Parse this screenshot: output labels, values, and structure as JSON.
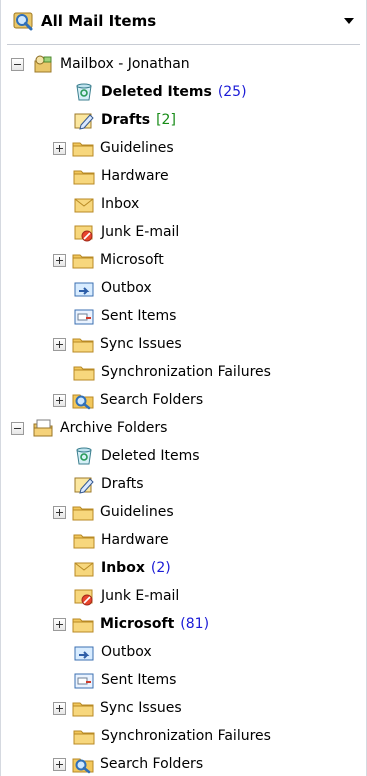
{
  "header": {
    "title": "All Mail Items",
    "icon": "search-folder-icon"
  },
  "tree": [
    {
      "id": "mailbox",
      "label": "Mailbox - Jonathan",
      "icon": "mailbox-icon",
      "expander": "minus",
      "level": 0,
      "bold": false
    },
    {
      "id": "mb-deleted",
      "label": "Deleted Items",
      "icon": "deleted-items-icon",
      "expander": "",
      "level": 1,
      "bold": true,
      "count": "(25)",
      "count_color": "blue"
    },
    {
      "id": "mb-drafts",
      "label": "Drafts",
      "icon": "drafts-icon",
      "expander": "",
      "level": 1,
      "bold": true,
      "count": "[2]",
      "count_color": "green"
    },
    {
      "id": "mb-guidelines",
      "label": "Guidelines",
      "icon": "folder-icon",
      "expander": "plus",
      "level": 1,
      "bold": false
    },
    {
      "id": "mb-hardware",
      "label": "Hardware",
      "icon": "folder-icon",
      "expander": "",
      "level": 1,
      "bold": false
    },
    {
      "id": "mb-inbox",
      "label": "Inbox",
      "icon": "inbox-icon",
      "expander": "",
      "level": 1,
      "bold": false
    },
    {
      "id": "mb-junk",
      "label": "Junk E-mail",
      "icon": "junk-email-icon",
      "expander": "",
      "level": 1,
      "bold": false
    },
    {
      "id": "mb-microsoft",
      "label": "Microsoft",
      "icon": "folder-icon",
      "expander": "plus",
      "level": 1,
      "bold": false
    },
    {
      "id": "mb-outbox",
      "label": "Outbox",
      "icon": "outbox-icon",
      "expander": "",
      "level": 1,
      "bold": false
    },
    {
      "id": "mb-sent",
      "label": "Sent Items",
      "icon": "sent-items-icon",
      "expander": "",
      "level": 1,
      "bold": false
    },
    {
      "id": "mb-sync",
      "label": "Sync Issues",
      "icon": "folder-icon",
      "expander": "plus",
      "level": 1,
      "bold": false
    },
    {
      "id": "mb-syncfail",
      "label": "Synchronization  Failures",
      "icon": "folder-icon",
      "expander": "",
      "level": 2,
      "bold": false
    },
    {
      "id": "mb-search",
      "label": "Search Folders",
      "icon": "search-folders-icon",
      "expander": "plus",
      "level": 1,
      "bold": false
    },
    {
      "id": "archive",
      "label": "Archive Folders",
      "icon": "archive-icon",
      "expander": "minus",
      "level": 0,
      "bold": false
    },
    {
      "id": "ar-deleted",
      "label": "Deleted Items",
      "icon": "deleted-items-icon",
      "expander": "",
      "level": 1,
      "bold": false
    },
    {
      "id": "ar-drafts",
      "label": "Drafts",
      "icon": "drafts-icon",
      "expander": "",
      "level": 1,
      "bold": false
    },
    {
      "id": "ar-guidelines",
      "label": "Guidelines",
      "icon": "folder-icon",
      "expander": "plus",
      "level": 1,
      "bold": false
    },
    {
      "id": "ar-hardware",
      "label": "Hardware",
      "icon": "folder-icon",
      "expander": "",
      "level": 1,
      "bold": false
    },
    {
      "id": "ar-inbox",
      "label": "Inbox",
      "icon": "inbox-icon",
      "expander": "",
      "level": 1,
      "bold": true,
      "count": "(2)",
      "count_color": "blue"
    },
    {
      "id": "ar-junk",
      "label": "Junk E-mail",
      "icon": "junk-email-icon",
      "expander": "",
      "level": 1,
      "bold": false
    },
    {
      "id": "ar-microsoft",
      "label": "Microsoft",
      "icon": "folder-icon",
      "expander": "plus",
      "level": 1,
      "bold": true,
      "count": "(81)",
      "count_color": "blue"
    },
    {
      "id": "ar-outbox",
      "label": "Outbox",
      "icon": "outbox-icon",
      "expander": "",
      "level": 1,
      "bold": false
    },
    {
      "id": "ar-sent",
      "label": "Sent Items",
      "icon": "sent-items-icon",
      "expander": "",
      "level": 1,
      "bold": false
    },
    {
      "id": "ar-sync",
      "label": "Sync Issues",
      "icon": "folder-icon",
      "expander": "plus",
      "level": 1,
      "bold": false
    },
    {
      "id": "ar-syncfail",
      "label": "Synchronization  Failures",
      "icon": "folder-icon",
      "expander": "",
      "level": 2,
      "bold": false
    },
    {
      "id": "ar-search",
      "label": "Search Folders",
      "icon": "search-folders-icon",
      "expander": "plus",
      "level": 1,
      "bold": false
    }
  ]
}
